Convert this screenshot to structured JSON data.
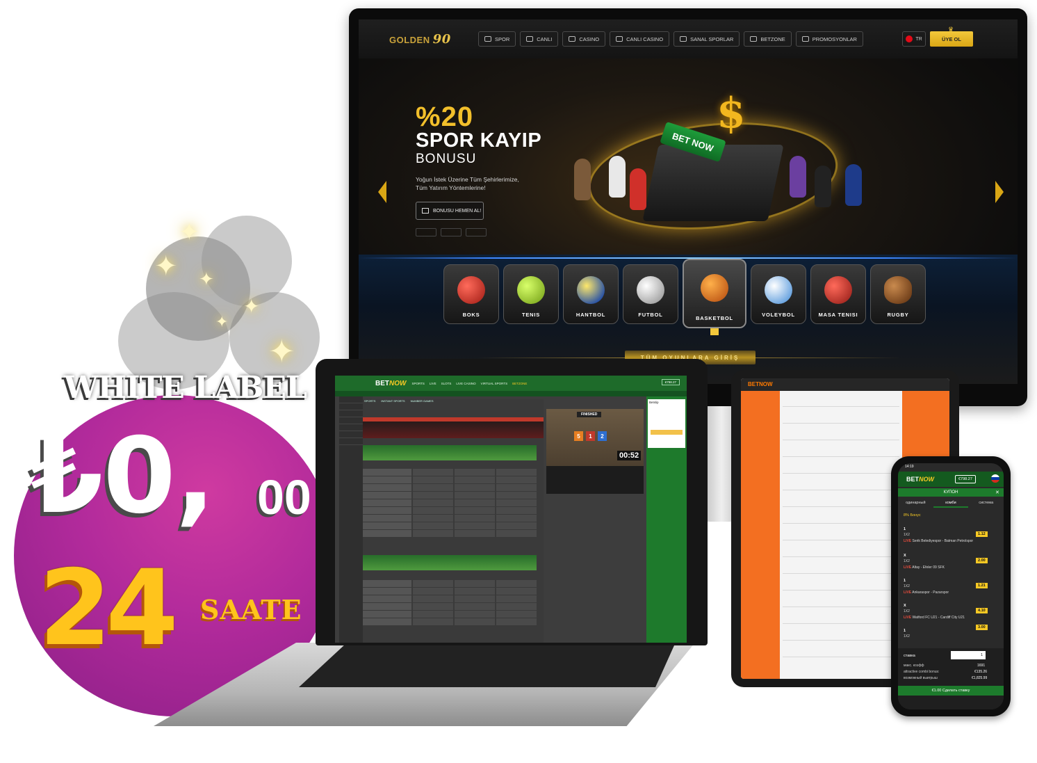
{
  "monitor": {
    "logo_text": "GOLDEN",
    "logo_number": "90",
    "nav": [
      {
        "label": "SPOR",
        "icon": "soccer-ball-icon"
      },
      {
        "label": "CANLI",
        "icon": "play-icon"
      },
      {
        "label": "CASINO",
        "icon": "chip-icon"
      },
      {
        "label": "CANLI CASINO",
        "icon": "slot-icon"
      },
      {
        "label": "SANAL SPORLAR",
        "icon": "controller-icon"
      },
      {
        "label": "BETZONE",
        "icon": "ticket-icon"
      },
      {
        "label": "PROMOSYONLAR",
        "icon": "gift-icon"
      }
    ],
    "lang": "TR",
    "signup": "ÜYE OL",
    "hero": {
      "pct": "%20",
      "title": "SPOR KAYIP",
      "subtitle": "BONUSU",
      "desc_line1": "Yoğun İstek Üzerine Tüm Şehirlerimize,",
      "desc_line2": "Tüm Yatırım Yöntemlerine!",
      "button": "BONUSU HEMEN AL!",
      "badge": "BET NOW"
    },
    "sports": [
      {
        "label": "BOKS",
        "color": "#c0392b"
      },
      {
        "label": "TENIS",
        "color": "#9bd42c"
      },
      {
        "label": "HANTBOL",
        "color": "#f2d21b"
      },
      {
        "label": "FUTBOL",
        "color": "#e8e8e8"
      },
      {
        "label": "BASKETBOL",
        "color": "#f07a1a"
      },
      {
        "label": "VOLEYBOL",
        "color": "#3aa0e8"
      },
      {
        "label": "MASA TENISI",
        "color": "#e0302b"
      },
      {
        "label": "RUGBY",
        "color": "#8a4b1c"
      }
    ],
    "all_games": "TÜM OYUNLARA GİRİŞ"
  },
  "promo": {
    "title": "WHITE LABEL",
    "price_main": "₺0,",
    "price_cents": "00",
    "hours": "24",
    "hours_unit": "SAATE"
  },
  "laptop": {
    "logo_a": "BET",
    "logo_b": "NOW",
    "menu": [
      "SPORTS",
      "LIVE",
      "SLOTS",
      "LIVE CASINO",
      "VIRTUAL SPORTS"
    ],
    "menu_highlight": "BETZONE",
    "account": "€798.27",
    "tabs": [
      "SPORTS",
      "INSTANT SPORTS",
      "NUMBER GAMES"
    ],
    "finished": "FINISHED",
    "scores": [
      {
        "value": "5",
        "color": "#e67e22"
      },
      {
        "value": "1",
        "color": "#c0392b"
      },
      {
        "value": "2",
        "color": "#2e6fd1"
      }
    ],
    "timer": "00:52",
    "betslip_tab": "Betslip"
  },
  "tablet": {
    "logo": "BETNOW"
  },
  "phone": {
    "time": "14:19",
    "logo_a": "BET",
    "logo_b": "NOW",
    "balance": "€798.27",
    "coupon": "КУПОН",
    "tabs": [
      "одинарный",
      "комби",
      "система"
    ],
    "bonus": "8% Бонус",
    "bets": [
      {
        "sel": "1",
        "market": "1X2",
        "event": "Serik Belediyespor - Batman Petrolspor",
        "odd": "1.12"
      },
      {
        "sel": "X",
        "market": "1X2",
        "event": "Altay - Efeler 09 SFK",
        "odd": "2.00"
      },
      {
        "sel": "1",
        "market": "1X2",
        "event": "Ankaraspor - Pazarspor",
        "odd": "1.21"
      },
      {
        "sel": "X",
        "market": "1X2",
        "event": "Watford FC U21 - Cardiff City U21",
        "odd": "4.10"
      },
      {
        "sel": "1",
        "market": "1X2",
        "event": "",
        "odd": "3.00"
      }
    ],
    "live": "LIVE",
    "stake_label": "ставка",
    "stake_value": "1",
    "info": [
      {
        "label": "макс. коэфф",
        "value": "1691"
      },
      {
        "label": "attractive combi bonus:",
        "value": "€135.26"
      },
      {
        "label": "возможный выигрыш",
        "value": "€1,825.99"
      }
    ],
    "submit": "€1.00 Сделать ставку"
  }
}
